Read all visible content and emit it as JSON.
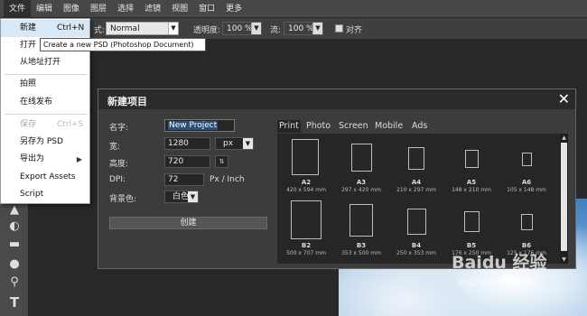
{
  "menubar": {
    "items": [
      "文件",
      "编辑",
      "图像",
      "图层",
      "选择",
      "滤镜",
      "视图",
      "窗口",
      "更多"
    ]
  },
  "optionsbar": {
    "mode_value": "Normal",
    "opacity_label": "透明度:",
    "opacity_value": "100 %",
    "flow_label": "流:",
    "flow_value": "100 %",
    "align_label": "对齐",
    "mode_label_suffix": "式:"
  },
  "file_menu": {
    "items": [
      {
        "label": "新建",
        "shortcut": "Ctrl+N",
        "highlighted": true
      },
      {
        "label": "打开",
        "shortcut": ""
      },
      {
        "label": "从地址打开",
        "shortcut": ""
      },
      {
        "label": "拍照",
        "shortcut": ""
      },
      {
        "label": "在线发布",
        "shortcut": ""
      },
      {
        "label": "保存",
        "shortcut": "Ctrl+S",
        "disabled": true
      },
      {
        "label": "另存为 PSD",
        "shortcut": ""
      },
      {
        "label": "导出为",
        "shortcut": "",
        "submenu": true
      },
      {
        "label": "Export Assets",
        "shortcut": ""
      },
      {
        "label": "Script",
        "shortcut": ""
      }
    ]
  },
  "tooltip": "Create a new PSD (Photoshop Document)",
  "dialog": {
    "title": "新建项目",
    "close_glyph": "✕",
    "name_label": "名字:",
    "name_value": "New Project",
    "width_label": "宽:",
    "width_value": "1280",
    "unit_value": "px",
    "height_label": "高度:",
    "height_value": "720",
    "dpi_label": "DPI:",
    "dpi_value": "72",
    "dpi_unit": "Px / Inch",
    "bg_label": "背景色:",
    "bg_value": "白色",
    "create_label": "创建",
    "tabs": [
      "Print",
      "Photo",
      "Screen",
      "Mobile",
      "Ads"
    ],
    "active_tab": "Print",
    "presets": [
      {
        "name": "A2",
        "dims": "420 x 594 mm"
      },
      {
        "name": "A3",
        "dims": "297 x 420 mm"
      },
      {
        "name": "A4",
        "dims": "210 x 297 mm"
      },
      {
        "name": "A5",
        "dims": "148 x 210 mm"
      },
      {
        "name": "A6",
        "dims": "105 x 148 mm"
      },
      {
        "name": "B2",
        "dims": "500 x 707 mm"
      },
      {
        "name": "B3",
        "dims": "353 x 500 mm"
      },
      {
        "name": "B4",
        "dims": "250 x 353 mm"
      },
      {
        "name": "B5",
        "dims": "176 x 250 mm"
      },
      {
        "name": "B6",
        "dims": "125 x 176 mm"
      }
    ]
  },
  "watermark": {
    "brand": "Baidu 经验",
    "url": "jingyan.baidu.com"
  },
  "icons": {
    "tools": [
      "stamp-icon",
      "eraser-icon",
      "gradient-icon",
      "drop-icon",
      "dodge-icon",
      "type-icon"
    ],
    "tool_glyphs": [
      "▲",
      "◐",
      "▬",
      "●",
      "⚲",
      "T"
    ]
  }
}
